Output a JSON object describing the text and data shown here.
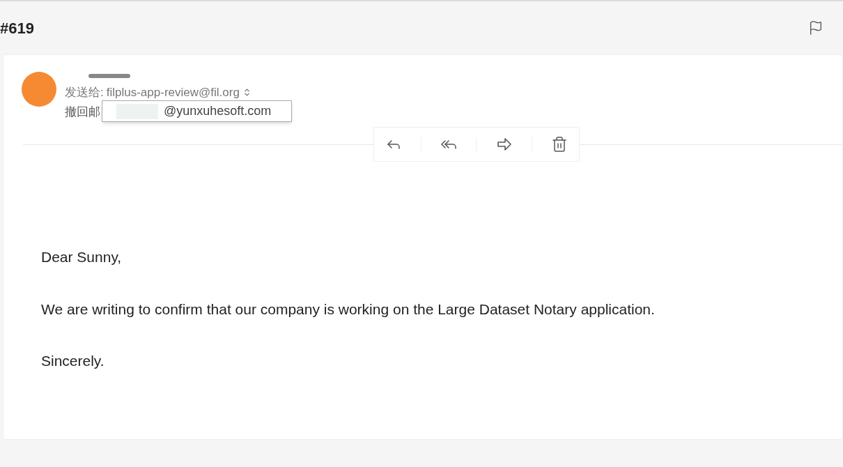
{
  "header": {
    "title": "#619"
  },
  "message": {
    "recipient_label": "发送给:",
    "recipient": "filplus-app-review@fil.org",
    "recall_label": "撤回邮",
    "tooltip": "@yunxuhesoft.com"
  },
  "body": [
    "Dear Sunny,",
    "We are writing to confirm that our company is working on the Large Dataset Notary application.",
    "Sincerely."
  ]
}
